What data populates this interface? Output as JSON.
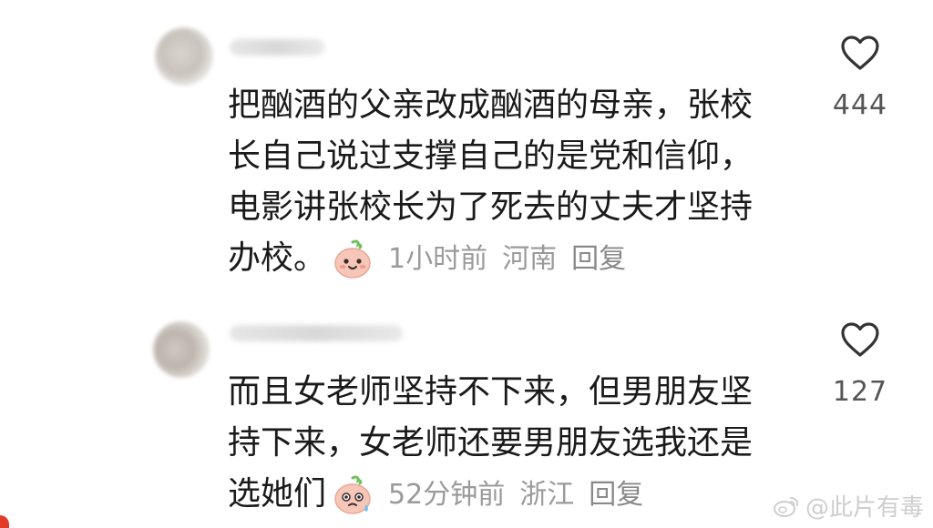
{
  "comments": [
    {
      "username": "",
      "lines": [
        "把酗酒的父亲改成酗酒的母亲，张校",
        "长自己说过支撑自己的是党和信仰，",
        "电影讲张校长为了死去的丈夫才坚持",
        "办校。"
      ],
      "time": "1小时前",
      "location": "河南",
      "reply_label": "回复",
      "like_count": "444",
      "emoji": "smiling-face-emoji"
    },
    {
      "username": "",
      "lines": [
        "而且女老师坚持不下来，但男朋友坚",
        "持下来，女老师还要男朋友选我还是",
        "选她们"
      ],
      "time": "52分钟前",
      "location": "浙江",
      "reply_label": "回复",
      "like_count": "127",
      "emoji": "sweating-face-emoji"
    }
  ],
  "watermark": {
    "text": "@此片有毒",
    "icon": "weibo-logo-icon"
  },
  "colors": {
    "text": "#1a1a1a",
    "meta": "#9a9a9a",
    "like": "#555555",
    "accent": "#e23b2a"
  }
}
